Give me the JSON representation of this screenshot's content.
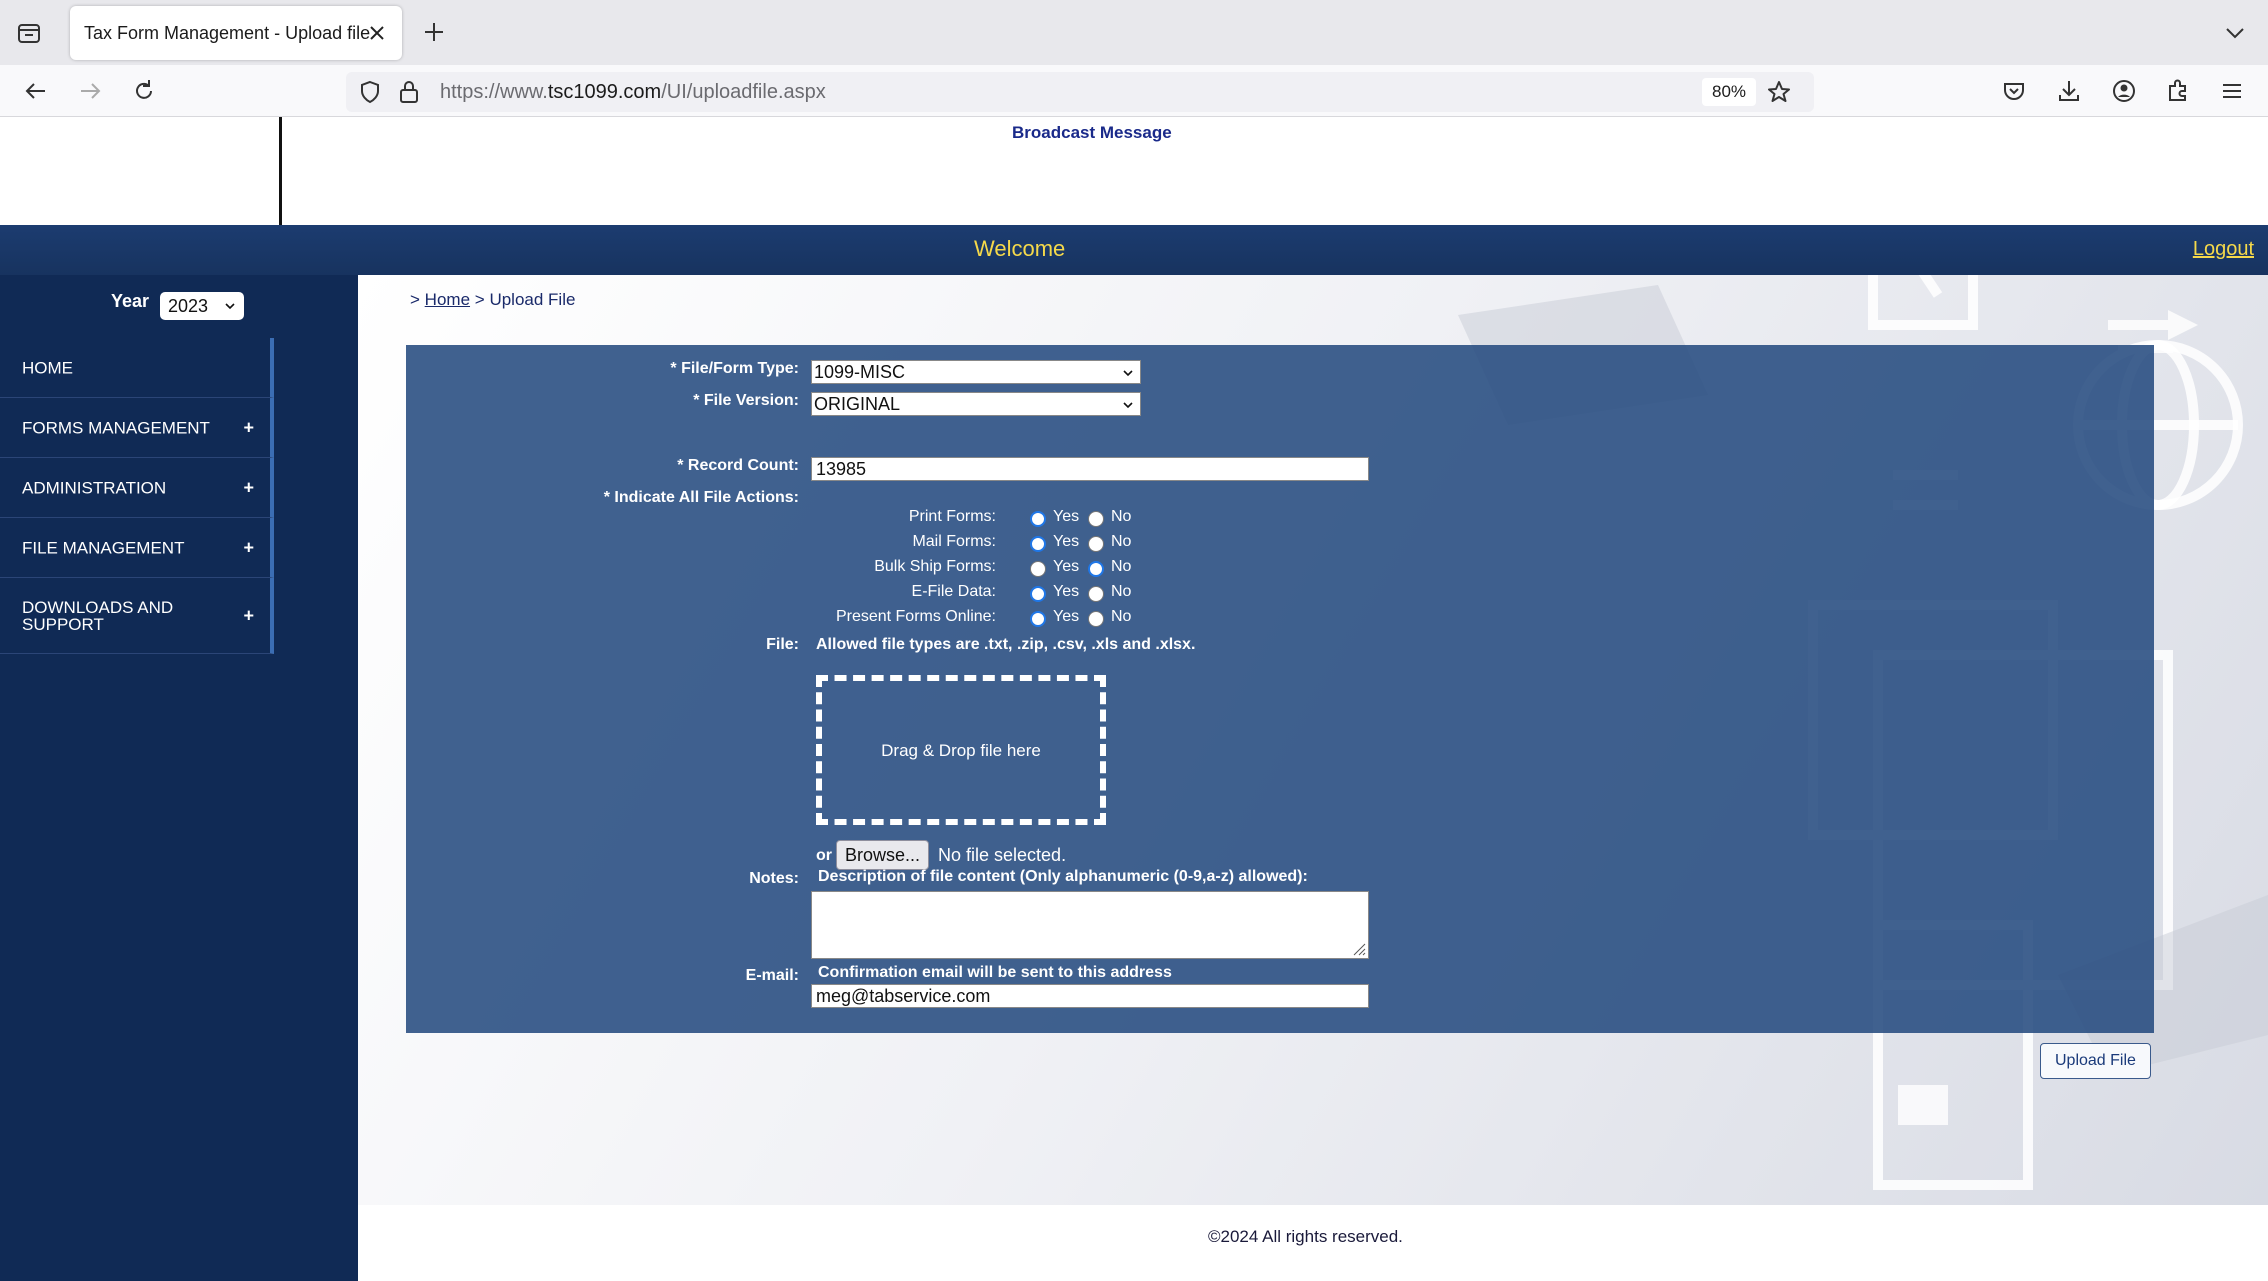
{
  "browser": {
    "tab_title": "Tax Form Management - Upload file",
    "url_prefix": "https://www.",
    "url_host": "tsc1099.com",
    "url_path": "/UI/uploadfile.aspx",
    "zoom": "80%"
  },
  "banner": {
    "broadcast": "Broadcast Message"
  },
  "header": {
    "welcome": "Welcome",
    "logout": "Logout"
  },
  "sidebar": {
    "year_label": "Year",
    "year_value": "2023",
    "items": [
      {
        "label": "HOME",
        "expandable": ""
      },
      {
        "label": "FORMS MANAGEMENT",
        "expandable": "+"
      },
      {
        "label": "ADMINISTRATION",
        "expandable": "+"
      },
      {
        "label": "FILE MANAGEMENT",
        "expandable": "+"
      },
      {
        "label": "DOWNLOADS AND SUPPORT",
        "expandable": "+"
      }
    ]
  },
  "breadcrumb": {
    "sep1": ">",
    "home": "Home",
    "sep2": ">",
    "current": "Upload File"
  },
  "form": {
    "form_type_label": "* File/Form Type:",
    "form_type_value": "1099-MISC",
    "version_label": "* File Version:",
    "version_value": "ORIGINAL",
    "record_count_label": "* Record Count:",
    "record_count_value": "13985",
    "actions_label": "* Indicate All File Actions:",
    "yes_label": "Yes",
    "no_label": "No",
    "actions": [
      {
        "label": "Print Forms:",
        "selected": "yes"
      },
      {
        "label": "Mail Forms:",
        "selected": "yes"
      },
      {
        "label": "Bulk Ship Forms:",
        "selected": "no"
      },
      {
        "label": "E-File Data:",
        "selected": "yes"
      },
      {
        "label": "Present Forms Online:",
        "selected": "yes"
      }
    ],
    "file_label": "File:",
    "allowed_types": "Allowed file types are .txt, .zip, .csv, .xls and .xlsx.",
    "dropzone_text": "Drag & Drop file here",
    "or_text": "or",
    "browse_label": "Browse...",
    "no_file_text": "No file selected.",
    "notes_label": "Notes:",
    "notes_hint": "Description of file content (Only alphanumeric (0-9,a-z) allowed):",
    "email_label": "E-mail:",
    "email_hint": "Confirmation email will be sent to this address",
    "email_value": "meg@tabservice.com",
    "upload_button": "Upload File"
  },
  "footer": {
    "copyright": "©2024 All rights reserved."
  }
}
